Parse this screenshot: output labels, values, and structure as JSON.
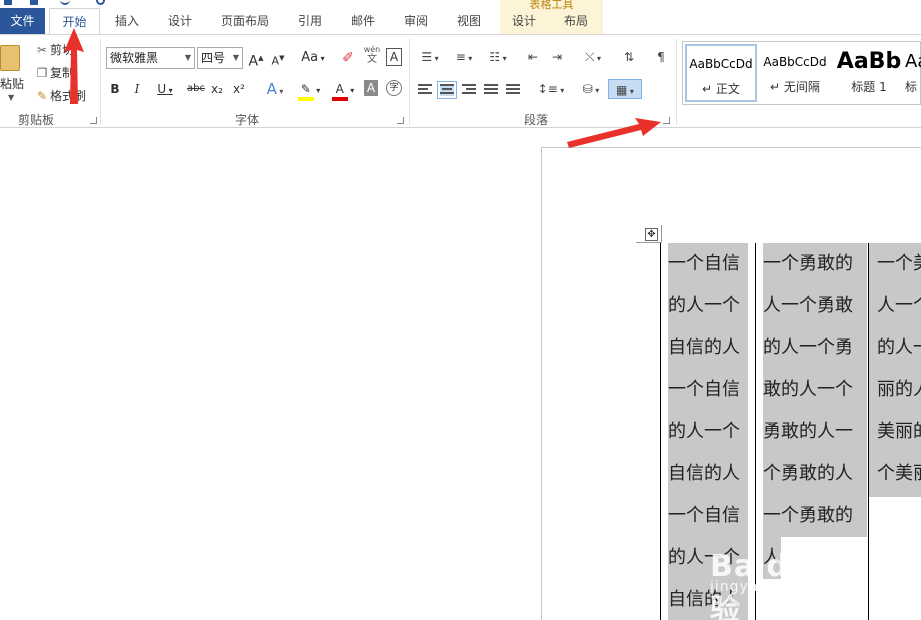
{
  "tabs": {
    "file": "文件",
    "home": "开始",
    "insert": "插入",
    "design": "设计",
    "page_layout": "页面布局",
    "references": "引用",
    "mailings": "邮件",
    "review": "审阅",
    "view": "视图",
    "table_design": "设计",
    "table_layout": "布局",
    "table_tools": "表格工具"
  },
  "clipboard": {
    "paste": "粘贴",
    "cut": "剪切",
    "copy": "复制",
    "format_painter": "格式刷",
    "label": "剪贴板"
  },
  "font": {
    "name": "微软雅黑",
    "size": "四号",
    "label": "字体",
    "bold": "B",
    "italic": "I",
    "underline": "U",
    "strike": "abc",
    "subscript": "x₂",
    "superscript": "x²",
    "grow": "A",
    "shrink": "A",
    "change_case": "Aa",
    "phonetic": "wén",
    "phonetic_sub": "文",
    "border_char": "A",
    "shading_char": "A",
    "enclose_char": "字"
  },
  "paragraph": {
    "label": "段落"
  },
  "styles": {
    "items": [
      {
        "sample": "AaBbCcDd",
        "name": "正文"
      },
      {
        "sample": "AaBbCcDd",
        "name": "无间隔"
      },
      {
        "sample": "AaBb",
        "name": "标题 1"
      },
      {
        "sample": "Aa",
        "name": "标"
      }
    ]
  },
  "table": {
    "columns": [
      [
        "一个自信",
        "的人一个",
        "自信的人",
        "一个自信",
        "的人一个",
        "自信的人",
        "一个自信",
        "的人一个",
        "自信的人"
      ],
      [
        "一个勇敢的",
        "人一个勇敢",
        "的人一个勇",
        "敢的人一个",
        "勇敢的人一",
        "个勇敢的人",
        "一个勇敢的",
        "人"
      ],
      [
        "一个美",
        "人一个",
        "的人一",
        "丽的人",
        "美丽的",
        "个美丽"
      ]
    ]
  },
  "watermark": {
    "brand": "Baidu经验",
    "url": "jingyan.baidu.com"
  },
  "colors": {
    "file_tab": "#2b579a",
    "highlight": "#c8c8c8",
    "arrow": "#e8312a",
    "table_tools_bg": "#fdf4d7"
  }
}
